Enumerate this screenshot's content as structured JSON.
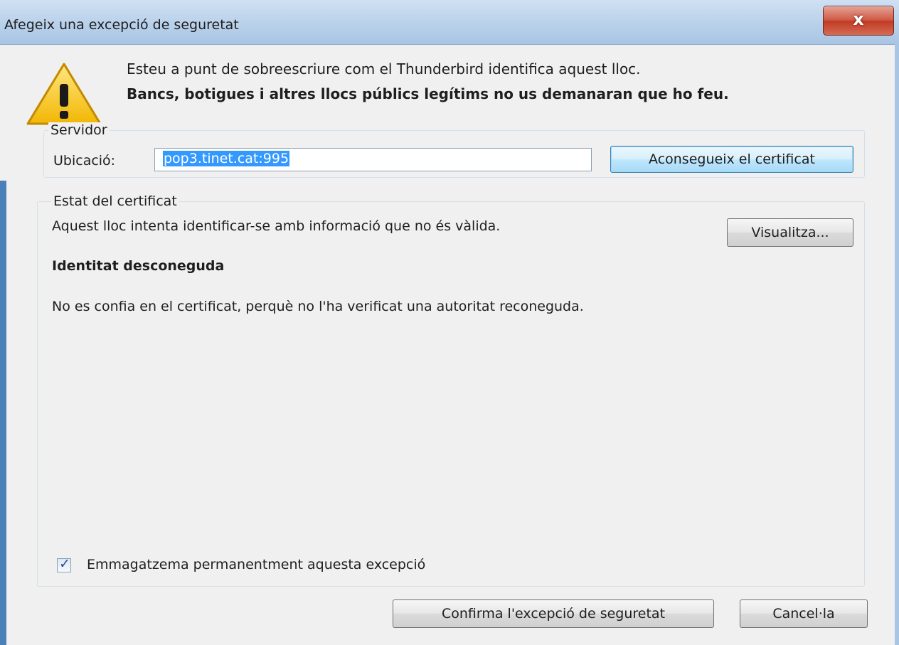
{
  "window": {
    "title": "Afegeix una excepció de seguretat",
    "close_glyph": "x",
    "accent_color": "#b9d1ea",
    "close_color": "#c13b24"
  },
  "warning": {
    "icon": "warning-triangle-icon",
    "line1": "Esteu a punt de sobreescriure com el Thunderbird identifica aquest lloc.",
    "line2": "Bancs, botigues i altres llocs públics legítims no us demanaran que ho feu."
  },
  "server": {
    "group_label": "Servidor",
    "location_label": "Ubicació:",
    "location_value": "pop3.tinet.cat:995",
    "get_certificate_button": "Aconsegueix el certificat"
  },
  "certificate_status": {
    "group_label": "Estat del certificat",
    "message": "Aquest lloc intenta identificar-se amb informació que no és vàlida.",
    "view_button": "Visualitza...",
    "identity_heading": "Identitat desconeguda",
    "trust_message": "No es confia en el certificat, perquè no l'ha verificat una autoritat reconeguda."
  },
  "permanent": {
    "checked": true,
    "label": "Emmagatzema permanentment aquesta excepció"
  },
  "actions": {
    "confirm_button": "Confirma l'excepció de seguretat",
    "cancel_button": "Cancel·la"
  }
}
